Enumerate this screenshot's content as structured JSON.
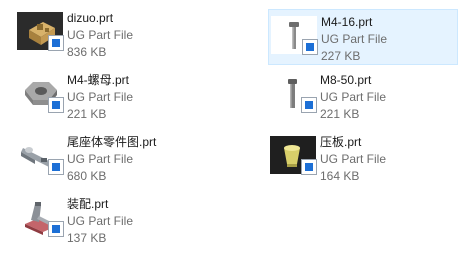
{
  "files": [
    {
      "name": "dizuo.prt",
      "type": "UG Part File",
      "size": "836 KB",
      "icon": "dizuo-part-thumbnail-icon",
      "selected": false
    },
    {
      "name": "M4-16.prt",
      "type": "UG Part File",
      "size": "227 KB",
      "icon": "m4-16-bolt-thumbnail-icon",
      "selected": true
    },
    {
      "name": "M4-螺母.prt",
      "type": "UG Part File",
      "size": "221 KB",
      "icon": "m4-nut-thumbnail-icon",
      "selected": false
    },
    {
      "name": "M8-50.prt",
      "type": "UG Part File",
      "size": "221 KB",
      "icon": "m8-50-bolt-thumbnail-icon",
      "selected": false
    },
    {
      "name": "尾座体零件图.prt",
      "type": "UG Part File",
      "size": "680 KB",
      "icon": "tailstock-body-thumbnail-icon",
      "selected": false
    },
    {
      "name": "压板.prt",
      "type": "UG Part File",
      "size": "164 KB",
      "icon": "pressure-plate-thumbnail-icon",
      "selected": false
    },
    {
      "name": "装配.prt",
      "type": "UG Part File",
      "size": "137 KB",
      "icon": "assembly-thumbnail-icon",
      "selected": false
    }
  ],
  "colors": {
    "selection_bg": "#e5f3ff",
    "selection_border": "#cce8ff",
    "filename_text": "#1b1b1b",
    "detail_text": "#6d6d6d",
    "app_badge_blue": "#1c6fd6"
  }
}
